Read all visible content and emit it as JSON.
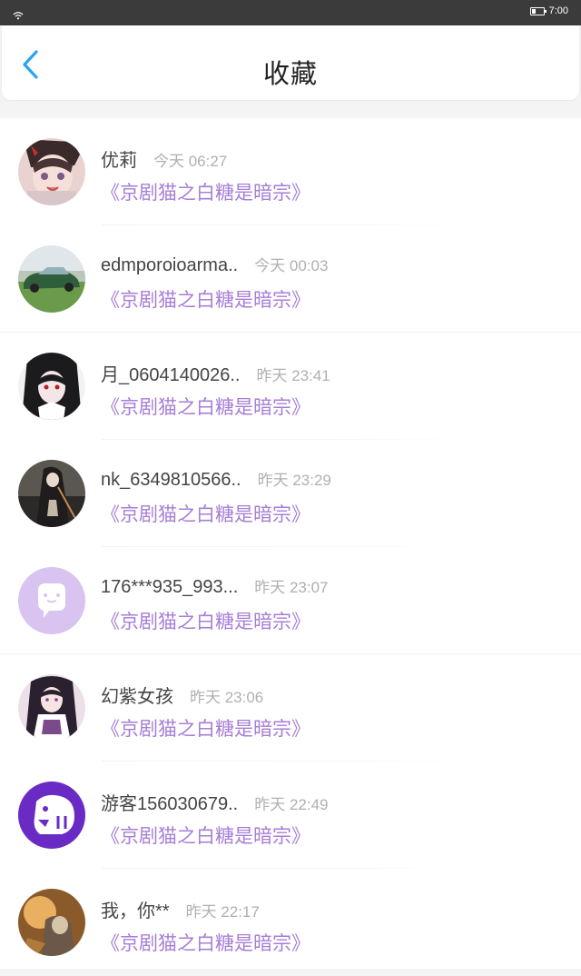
{
  "status_bar": {
    "time": "7:00"
  },
  "header": {
    "title": "收藏"
  },
  "items": [
    {
      "username": "优莉",
      "time": "今天 06:27",
      "book": "《京剧猫之白糖是暗宗》",
      "avatar_icon": "anime-girl-avatar"
    },
    {
      "username": "edmporoioarma..",
      "time": "今天 00:03",
      "book": "《京剧猫之白糖是暗宗》",
      "avatar_icon": "green-car-avatar"
    },
    {
      "username": "月_0604140026..",
      "time": "昨天 23:41",
      "book": "《京剧猫之白糖是暗宗》",
      "avatar_icon": "dark-hair-girl-avatar"
    },
    {
      "username": "nk_6349810566..",
      "time": "昨天 23:29",
      "book": "《京剧猫之白糖是暗宗》",
      "avatar_icon": "anime-figure-avatar"
    },
    {
      "username": "176***935_993...",
      "time": "昨天 23:07",
      "book": "《京剧猫之白糖是暗宗》",
      "avatar_icon": "default-chat-avatar"
    },
    {
      "username": "幻紫女孩",
      "time": "昨天 23:06",
      "book": "《京剧猫之白糖是暗宗》",
      "avatar_icon": "anime-girl-purple-avatar"
    },
    {
      "username": "游客156030679..",
      "time": "昨天 22:49",
      "book": "《京剧猫之白糖是暗宗》",
      "avatar_icon": "purple-mascot-avatar"
    },
    {
      "username": "我，你**",
      "time": "昨天 22:17",
      "book": "《京剧猫之白糖是暗宗》",
      "avatar_icon": "golden-art-avatar"
    }
  ],
  "colors": {
    "accent_blue": "#2aa3f0",
    "book_purple": "#a77ed6",
    "time_gray": "#b0b0b0"
  }
}
